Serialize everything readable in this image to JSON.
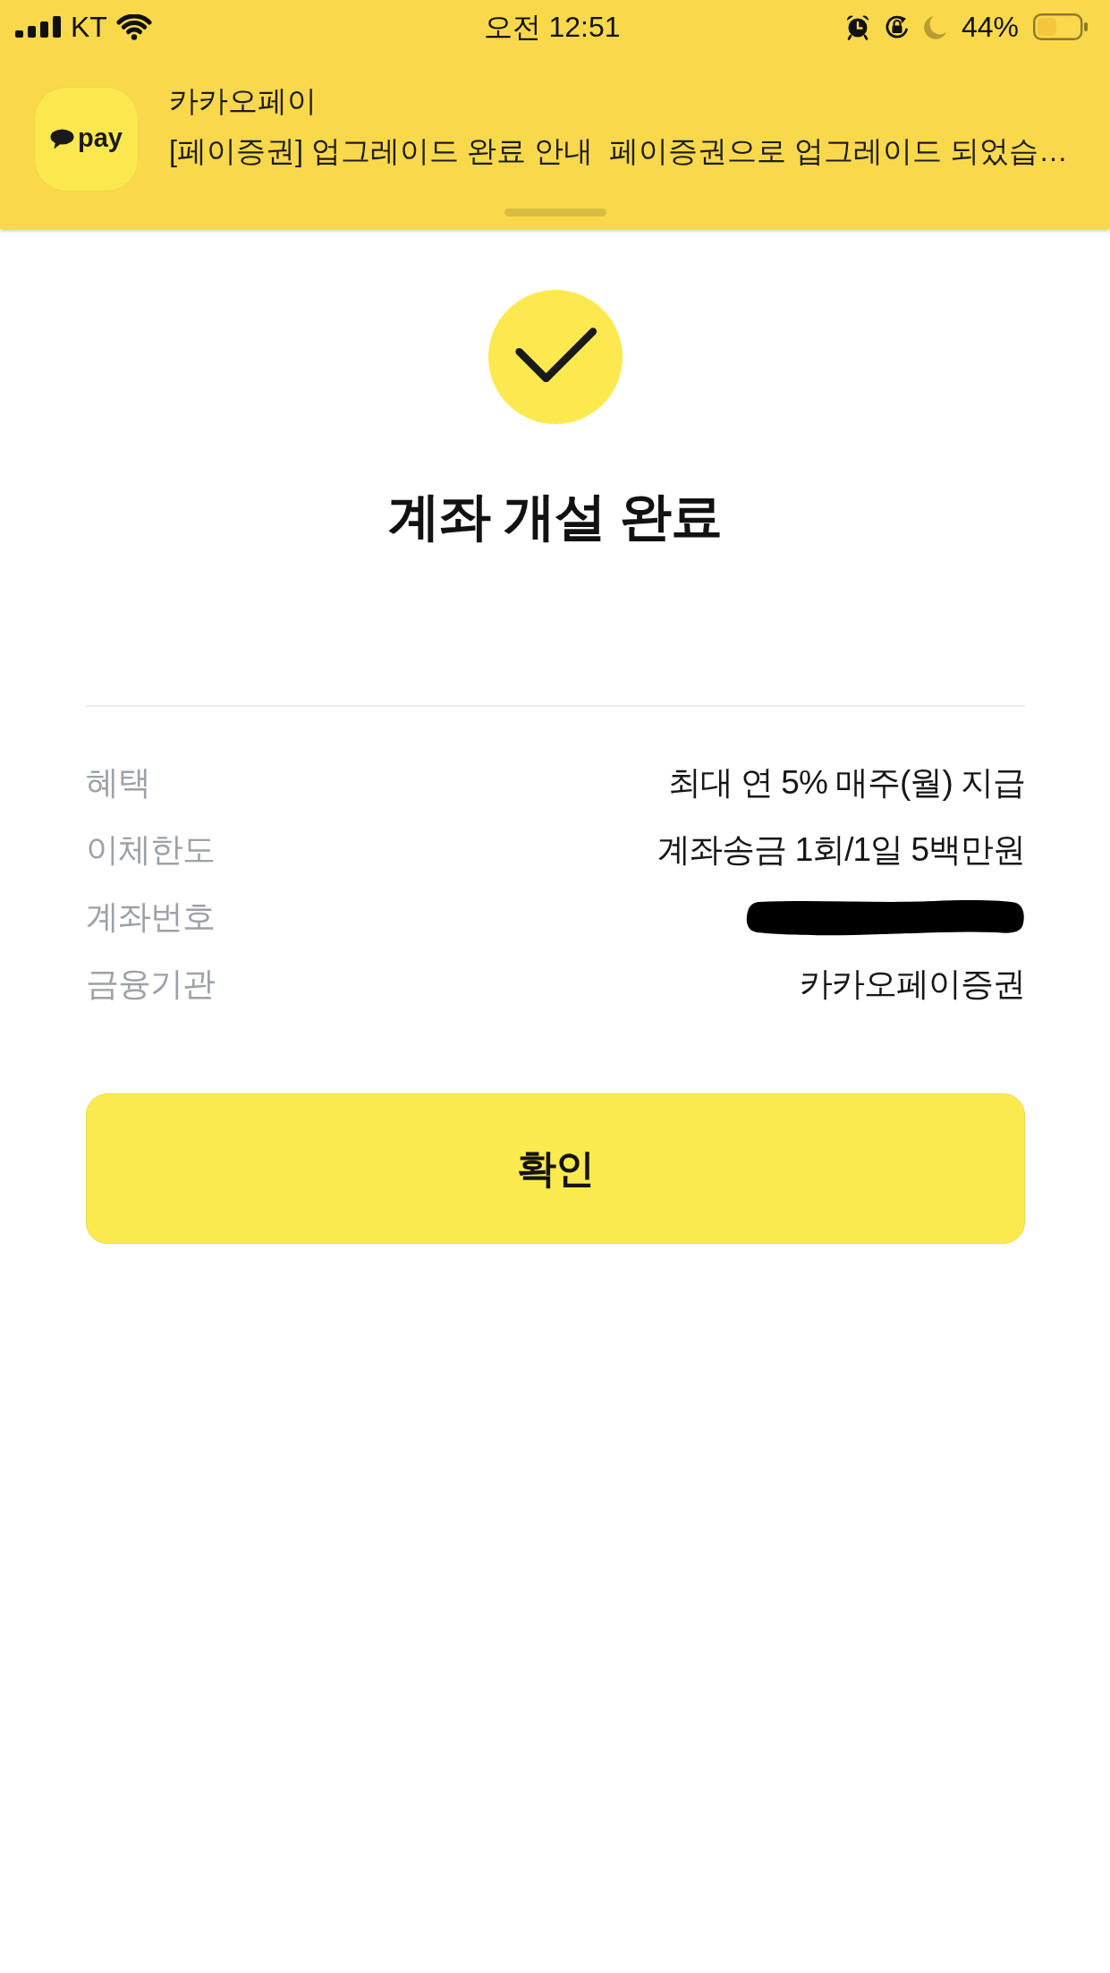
{
  "status_bar": {
    "carrier": "KT",
    "time": "오전 12:51",
    "battery_percent": "44%"
  },
  "notification": {
    "app_name": "카카오페이",
    "logo_text": "pay",
    "message": "[페이증권] 업그레이드 완료 안내  페이증권으로 업그레이드 되었습…"
  },
  "result": {
    "title": "계좌 개설 완료"
  },
  "details": [
    {
      "kind": "text",
      "label": "혜택",
      "value": "최대 연 5% 매주(월) 지급"
    },
    {
      "kind": "text",
      "label": "이체한도",
      "value": "계좌송금 1회/1일 5백만원"
    },
    {
      "kind": "redacted",
      "label": "계좌번호"
    },
    {
      "kind": "text",
      "label": "금융기관",
      "value": "카카오페이증권"
    }
  ],
  "confirm_button": {
    "label": "확인"
  }
}
